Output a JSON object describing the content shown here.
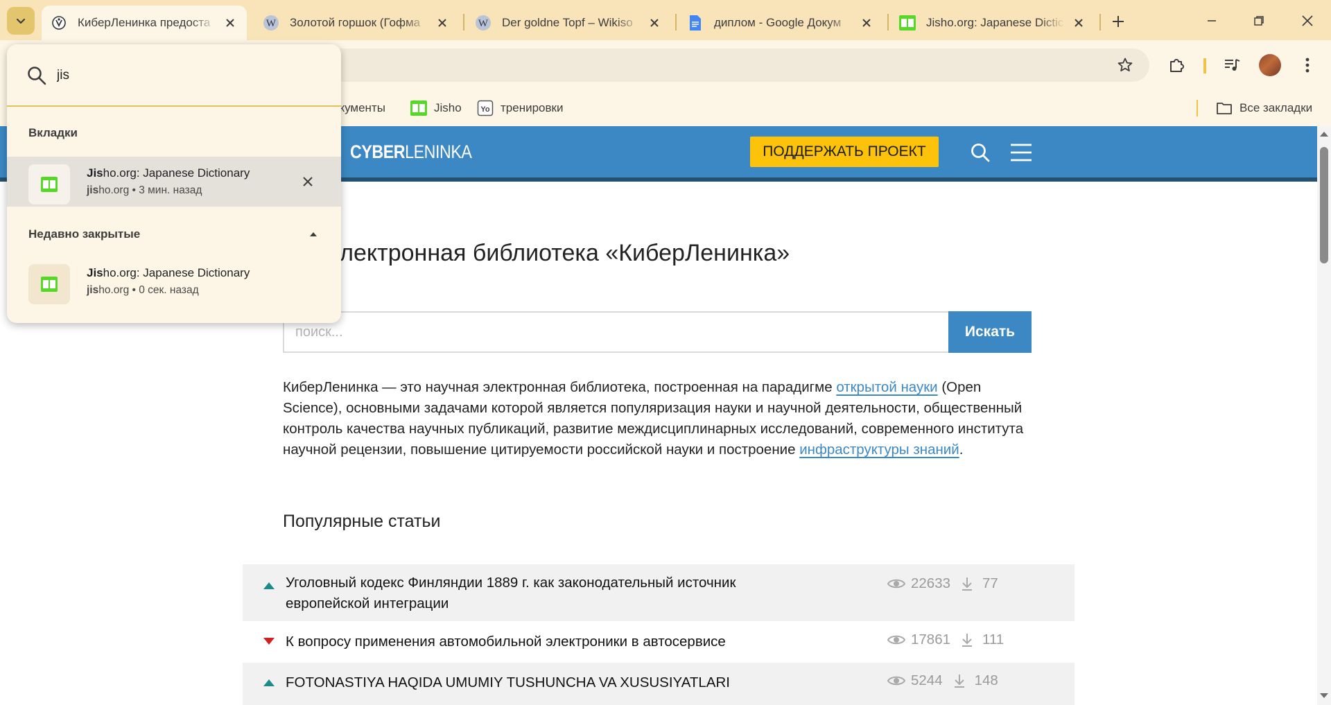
{
  "browser": {
    "tabs": [
      {
        "title": "КиберЛенинка предоста",
        "favicon": "cyberleninka-icon",
        "active": true
      },
      {
        "title": "Золотой горшок (Гофма",
        "favicon": "wikipedia-icon",
        "active": false
      },
      {
        "title": "Der goldne Topf – Wikiso",
        "favicon": "wikisource-icon",
        "active": false
      },
      {
        "title": "диплом - Google Докум",
        "favicon": "google-docs-icon",
        "active": false
      },
      {
        "title": "Jisho.org: Japanese Dictic",
        "favicon": "jisho-icon",
        "active": false
      }
    ],
    "bookmarks": [
      {
        "label": "окументы",
        "icon": "google-docs-icon"
      },
      {
        "label": "Jisho",
        "icon": "jisho-icon"
      },
      {
        "label": "тренировки",
        "icon": "yo-icon"
      }
    ],
    "all_bookmarks_label": "Все закладки",
    "colors": {
      "tabstrip": "#f9e4b9",
      "toolbar": "#fdf6e6",
      "accent": "#e3c56e"
    }
  },
  "tab_search": {
    "query": "jis",
    "open_section": "Вкладки",
    "open_tabs": [
      {
        "title_match": "Jis",
        "title_rest": "ho.org: Japanese Dictionary",
        "domain_match": "jis",
        "domain_rest": "ho.org",
        "meta": " • 3 мин. назад"
      }
    ],
    "closed_section": "Недавно закрытые",
    "closed_tabs": [
      {
        "title_match": "Jis",
        "title_rest": "ho.org: Japanese Dictionary",
        "domain_match": "jis",
        "domain_rest": "ho.org",
        "meta": " • 0 сек. назад"
      }
    ]
  },
  "site": {
    "logo_bold": "CYBER",
    "logo_light": "LENINKA",
    "support_button": "ПОДДЕРЖАТЬ ПРОЕКТ",
    "title_visible": "ная электронная библиотека «КиберЛенинка»",
    "search_placeholder": "поиск...",
    "search_button": "Искать",
    "intro_part1": "КиберЛенинка — это научная электронная библиотека, построенная на парадигме ",
    "intro_link1": "открытой науки",
    "intro_part2": " (Open Science), основными задачами которой является популяризация науки и научной деятельности, общественный контроль качества научных публикаций, развитие междисциплинарных исследований, современного института научной рецензии, повышение цитируемости российской науки и построение ",
    "intro_link2": "инфраструктуры знаний",
    "intro_part3": ".",
    "popular_title": "Популярные статьи",
    "articles": [
      {
        "trend": "up",
        "title": "Уголовный кодекс Финляндии 1889 г. как законодательный источник европейской интеграции",
        "views": "22633",
        "downloads": "77"
      },
      {
        "trend": "down",
        "title": "К вопросу применения автомобильной электроники в автосервисе",
        "views": "17861",
        "downloads": "111"
      },
      {
        "trend": "up",
        "title": "FOTONASTIYA HAQIDA UMUMIY TUSHUNCHA VA XUSUSIYATLARI",
        "views": "5244",
        "downloads": "148"
      }
    ],
    "colors": {
      "header": "#3b88c4",
      "button": "#fcc30a",
      "trend_up": "#1e8a8a",
      "trend_down": "#d42020"
    }
  }
}
